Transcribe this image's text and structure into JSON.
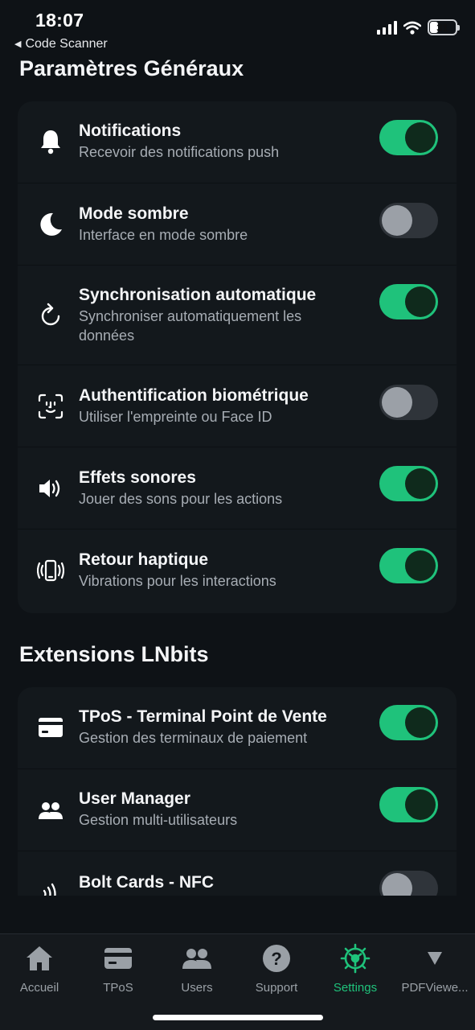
{
  "status_bar": {
    "time": "18:07",
    "back_label": "Code Scanner",
    "battery": "31"
  },
  "sections": [
    {
      "title": "Paramètres Généraux",
      "items": [
        {
          "icon": "bell-icon",
          "label": "Notifications",
          "desc": "Recevoir des notifications push",
          "enabled": true
        },
        {
          "icon": "moon-icon",
          "label": "Mode sombre",
          "desc": "Interface en mode sombre",
          "enabled": false
        },
        {
          "icon": "refresh-icon",
          "label": "Synchronisation automatique",
          "desc": "Synchroniser automatiquement les données",
          "enabled": true
        },
        {
          "icon": "face-id-icon",
          "label": "Authentification biométrique",
          "desc": "Utiliser l'empreinte ou Face ID",
          "enabled": false
        },
        {
          "icon": "speaker-icon",
          "label": "Effets sonores",
          "desc": "Jouer des sons pour les actions",
          "enabled": true
        },
        {
          "icon": "vibration-icon",
          "label": "Retour haptique",
          "desc": "Vibrations pour les interactions",
          "enabled": true
        }
      ]
    },
    {
      "title": "Extensions LNbits",
      "items": [
        {
          "icon": "credit-card-icon",
          "label": "TPoS - Terminal Point de Vente",
          "desc": "Gestion des terminaux de paiement",
          "enabled": true
        },
        {
          "icon": "users-icon",
          "label": "User Manager",
          "desc": "Gestion multi-utilisateurs",
          "enabled": true
        },
        {
          "icon": "nfc-icon",
          "label": "Bolt Cards - NFC",
          "desc": "",
          "enabled": false
        }
      ]
    }
  ],
  "tabs": [
    {
      "icon": "home-icon",
      "label": "Accueil",
      "active": false
    },
    {
      "icon": "tpos-card-icon",
      "label": "TPoS",
      "active": false
    },
    {
      "icon": "users-tab-icon",
      "label": "Users",
      "active": false
    },
    {
      "icon": "help-icon",
      "label": "Support",
      "active": false
    },
    {
      "icon": "settings-gear-icon",
      "label": "Settings",
      "active": true
    },
    {
      "icon": "chevron-down-icon",
      "label": "PDFViewe...",
      "active": false
    }
  ],
  "colors": {
    "accent": "#1fc27b",
    "background": "#0e1216",
    "card": "#13181c"
  }
}
